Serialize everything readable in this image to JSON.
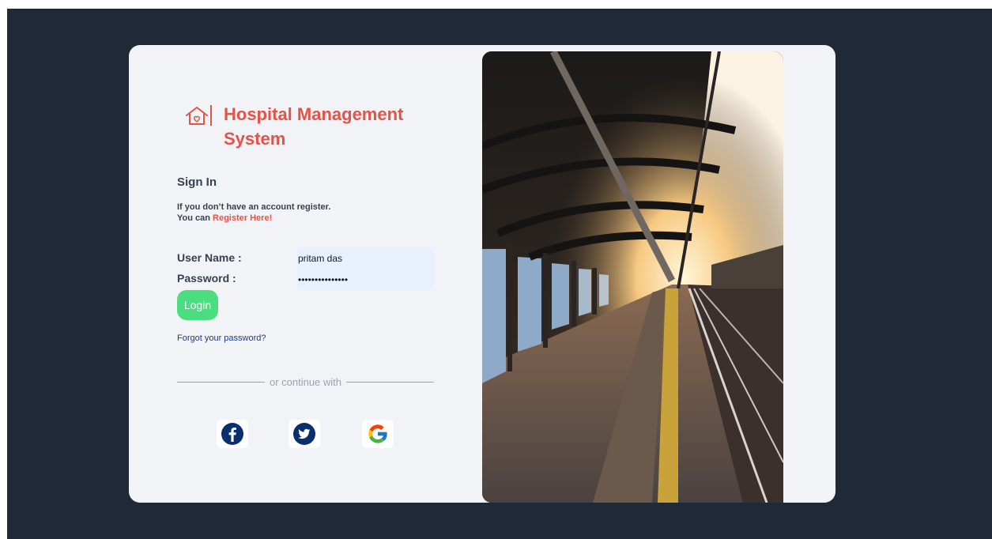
{
  "brand": {
    "title_line1": "Hospital Management",
    "title_line2": "System",
    "icon": "house-heart-icon",
    "accent_color": "#e55347"
  },
  "signin": {
    "title": "Sign In",
    "note_line1": "If you don’t have an account register.",
    "note_prefix": "You can ",
    "register_link": "Register Here!"
  },
  "form": {
    "username_label": "User Name :",
    "password_label": "Password :",
    "username_value": "pritam das",
    "password_value": "•••••••••••••••",
    "login_label": "Login",
    "forgot_label": "Forgot your password?"
  },
  "divider": {
    "text": "or continue with"
  },
  "social": [
    {
      "name": "facebook",
      "icon": "facebook-icon",
      "color": "#0a2f6e"
    },
    {
      "name": "twitter",
      "icon": "twitter-icon",
      "color": "#0a2f6e"
    },
    {
      "name": "google",
      "icon": "google-icon"
    }
  ],
  "colors": {
    "page_bg": "#1f2937",
    "card_bg": "#f1f3f6",
    "login_button": "#4ade80"
  }
}
